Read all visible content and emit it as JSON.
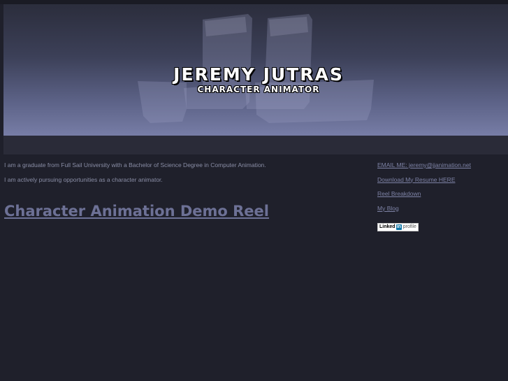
{
  "header": {
    "title": "JEREMY JUTRAS",
    "subtitle": "CHARACTER ANIMATOR",
    "logo_icon": "jj-monogram-logo"
  },
  "intro": {
    "line1": "I am a graduate from Full Sail University with a Bachelor of Science Degree in Computer Animation.",
    "line2": "I am actively pursuing opportunities as a character animator."
  },
  "main": {
    "reel_heading": "Character Animation Demo Reel"
  },
  "sidebar": {
    "links": [
      {
        "label": "EMAIL ME: jeremy@jjanimation.net"
      },
      {
        "label": "Download My Resume HERE"
      },
      {
        "label": "Reel Breakdown"
      },
      {
        "label": "My Blog"
      }
    ],
    "linkedin": {
      "brand": "Linked",
      "in": "in",
      "profile": "profile",
      "icon": "linkedin-profile-badge"
    }
  },
  "colors": {
    "background": "#1f202b",
    "link": "#7e83a6",
    "heading": "#6d7196",
    "text": "#8a8ea6",
    "linkedin_blue": "#0e76a8"
  }
}
